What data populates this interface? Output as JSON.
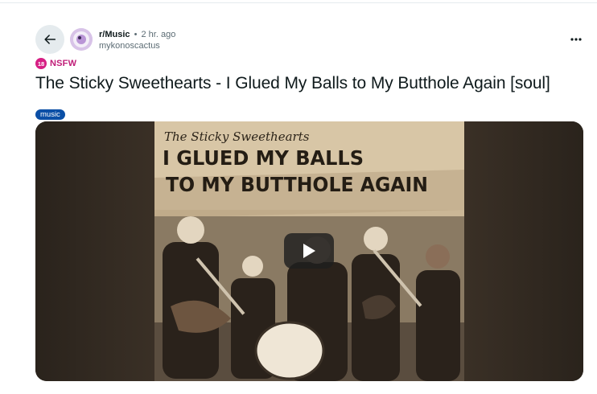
{
  "post": {
    "subreddit": "r/Music",
    "separator": "•",
    "time": "2 hr. ago",
    "author": "mykonoscactus",
    "nsfw_badge": "18",
    "nsfw_label": "NSFW",
    "title": "The Sticky Sweethearts - I Glued My Balls to My Butthole Again [soul]",
    "flair": "music"
  },
  "media": {
    "cover_band_name": "The Sticky Sweethearts",
    "cover_title_line1": "I GLUED MY BALLS",
    "cover_title_line2": "TO MY BUTTHOLE AGAIN"
  },
  "icons": {
    "back": "arrow-left-icon",
    "more": "overflow-menu-icon",
    "play": "play-icon"
  },
  "colors": {
    "nsfw": "#d61f84",
    "flair": "#0b4fa6",
    "back_button_bg": "#e5ebee"
  }
}
